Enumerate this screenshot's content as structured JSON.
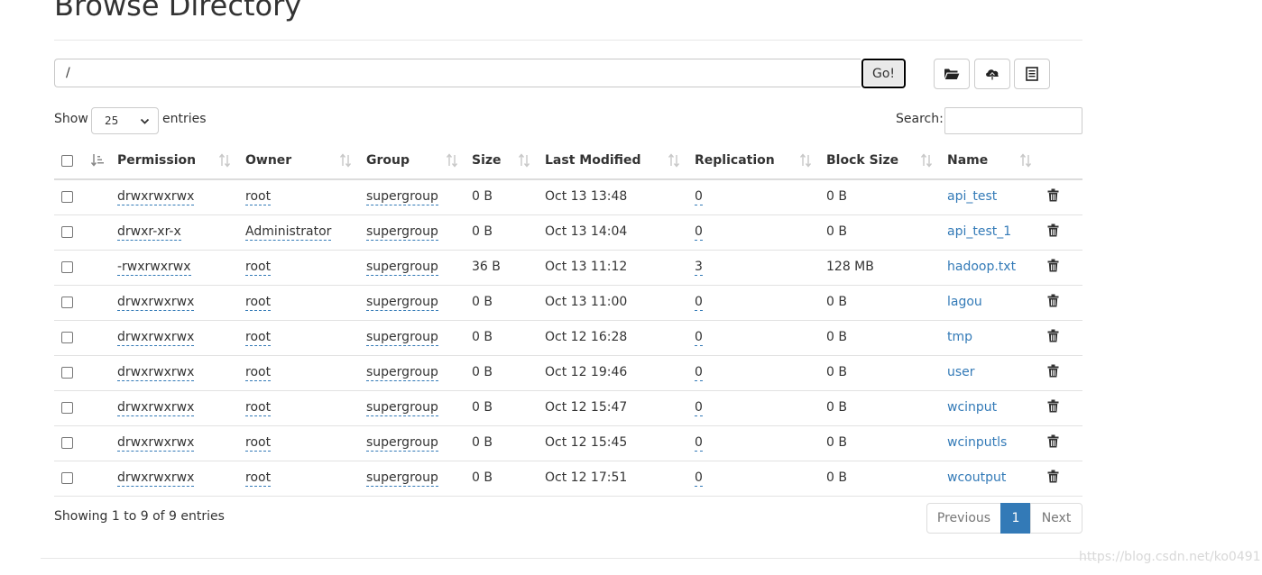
{
  "page": {
    "title": "Browse Directory"
  },
  "toolbar": {
    "path_value": "/",
    "go_label": "Go!",
    "icons": [
      "folder-open-icon",
      "upload-icon",
      "list-icon"
    ]
  },
  "controls": {
    "show_label": "Show",
    "page_size": "25",
    "entries_label": "entries",
    "search_label": "Search:",
    "search_value": ""
  },
  "table": {
    "columns": [
      "Permission",
      "Owner",
      "Group",
      "Size",
      "Last Modified",
      "Replication",
      "Block Size",
      "Name"
    ],
    "rows": [
      {
        "permission": "drwxrwxrwx",
        "owner": "root",
        "group": "supergroup",
        "size": "0 B",
        "modified": "Oct 13 13:48",
        "replication": "0",
        "block_size": "0 B",
        "name": "api_test"
      },
      {
        "permission": "drwxr-xr-x",
        "owner": "Administrator",
        "group": "supergroup",
        "size": "0 B",
        "modified": "Oct 13 14:04",
        "replication": "0",
        "block_size": "0 B",
        "name": "api_test_1"
      },
      {
        "permission": "-rwxrwxrwx",
        "owner": "root",
        "group": "supergroup",
        "size": "36 B",
        "modified": "Oct 13 11:12",
        "replication": "3",
        "block_size": "128 MB",
        "name": "hadoop.txt"
      },
      {
        "permission": "drwxrwxrwx",
        "owner": "root",
        "group": "supergroup",
        "size": "0 B",
        "modified": "Oct 13 11:00",
        "replication": "0",
        "block_size": "0 B",
        "name": "lagou"
      },
      {
        "permission": "drwxrwxrwx",
        "owner": "root",
        "group": "supergroup",
        "size": "0 B",
        "modified": "Oct 12 16:28",
        "replication": "0",
        "block_size": "0 B",
        "name": "tmp"
      },
      {
        "permission": "drwxrwxrwx",
        "owner": "root",
        "group": "supergroup",
        "size": "0 B",
        "modified": "Oct 12 19:46",
        "replication": "0",
        "block_size": "0 B",
        "name": "user"
      },
      {
        "permission": "drwxrwxrwx",
        "owner": "root",
        "group": "supergroup",
        "size": "0 B",
        "modified": "Oct 12 15:47",
        "replication": "0",
        "block_size": "0 B",
        "name": "wcinput"
      },
      {
        "permission": "drwxrwxrwx",
        "owner": "root",
        "group": "supergroup",
        "size": "0 B",
        "modified": "Oct 12 15:45",
        "replication": "0",
        "block_size": "0 B",
        "name": "wcinputls"
      },
      {
        "permission": "drwxrwxrwx",
        "owner": "root",
        "group": "supergroup",
        "size": "0 B",
        "modified": "Oct 12 17:51",
        "replication": "0",
        "block_size": "0 B",
        "name": "wcoutput"
      }
    ]
  },
  "footer": {
    "info": "Showing 1 to 9 of 9 entries",
    "prev_label": "Previous",
    "current_page": "1",
    "next_label": "Next"
  },
  "watermark": "https://blog.csdn.net/ko0491",
  "colors": {
    "link": "#337ab7",
    "active_page": "#337ab7"
  }
}
